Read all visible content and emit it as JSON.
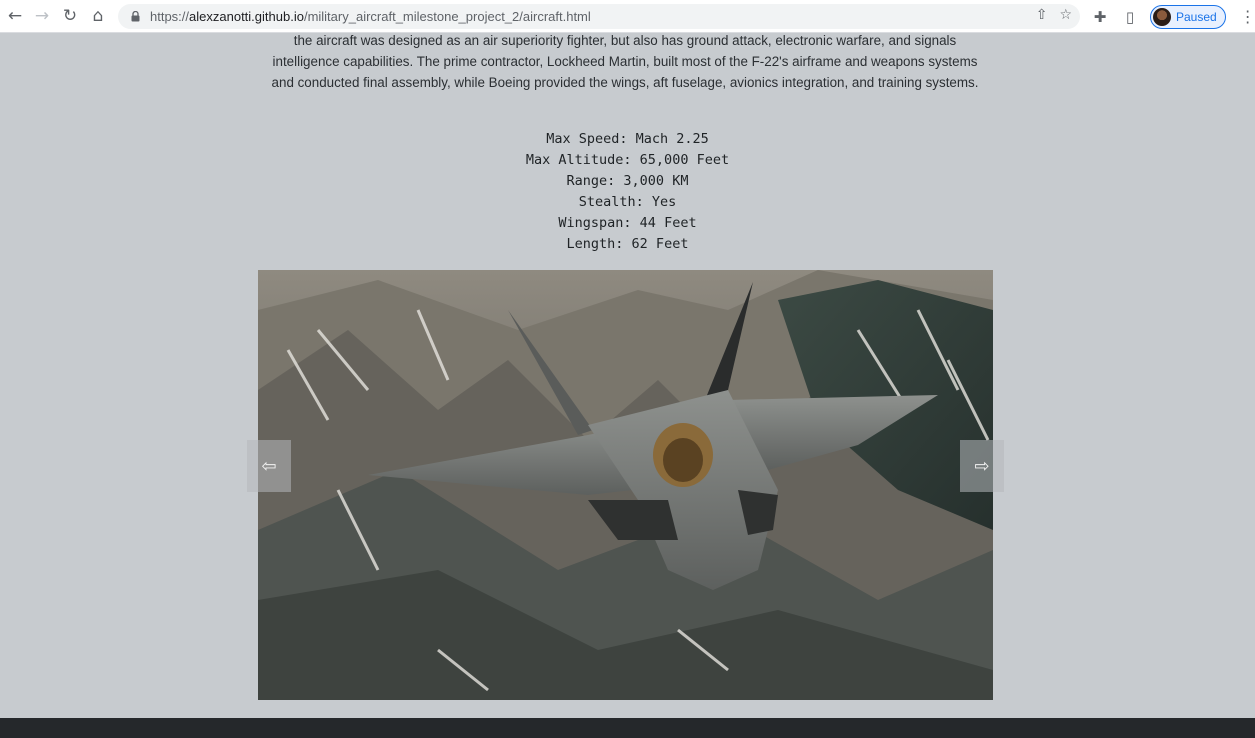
{
  "browser": {
    "url_scheme": "https://",
    "url_host": "alexzanotti.github.io",
    "url_path": "/military_aircraft_milestone_project_2/aircraft.html",
    "profile_status": "Paused"
  },
  "aircraft": {
    "description": "the aircraft was designed as an air superiority fighter, but also has ground attack, electronic warfare, and signals intelligence capabilities. The prime contractor, Lockheed Martin, built most of the F-22's airframe and weapons systems and conducted final assembly, while Boeing provided the wings, aft fuselage, avionics integration, and training systems.",
    "specs": [
      "Max Speed: Mach 2.25",
      "Max Altitude: 65,000 Feet",
      "Range: 3,000 KM",
      "Stealth: Yes",
      "Wingspan: 44 Feet",
      "Length: 62 Feet"
    ]
  },
  "carousel": {
    "prev_glyph": "⇦",
    "next_glyph": "⇨"
  },
  "colors": {
    "page_background": "#c7cbcf",
    "footer": "#25282b",
    "profile_accent": "#1a73e8"
  }
}
